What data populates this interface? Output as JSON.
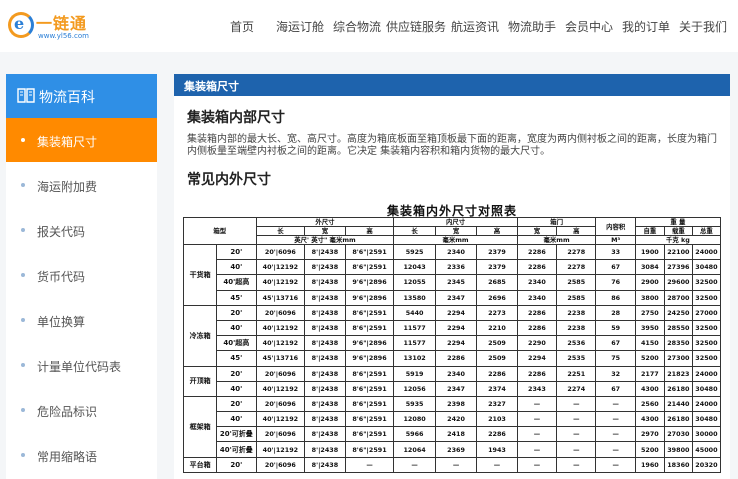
{
  "header": {
    "logo": {
      "name": "一链通",
      "url": "www.yl56.com",
      "mark": "e"
    },
    "nav": [
      "首页",
      "海运订舱",
      "综合物流",
      "供应链服务",
      "航运资讯",
      "物流助手",
      "会员中心",
      "我的订单",
      "关于我们"
    ]
  },
  "sidebar": {
    "title": "物流百科",
    "icon": "book-icon",
    "items": [
      "集装箱尺寸",
      "海运附加费",
      "报关代码",
      "货币代码",
      "单位换算",
      "计量单位代码表",
      "危险品标识",
      "常用缩略语"
    ],
    "active_index": 0
  },
  "content": {
    "bar_title": "集装箱尺寸",
    "heading1": "集装箱内部尺寸",
    "paragraph": "集装箱内部的最大长、宽、高尺寸。高度为箱底板面至箱顶板最下面的距离，宽度为两内侧衬板之间的距离，长度为箱门内侧板量至端壁内衬板之间的距离。它决定 集装箱内容积和箱内货物的最大尺寸。",
    "heading2": "常见内外尺寸",
    "table": {
      "title": "集装箱内外尺寸对照表",
      "header_row1": [
        "箱型",
        "外尺寸",
        "内尺寸",
        "箱门",
        "内容积",
        "重 量"
      ],
      "header_row2": [
        "长",
        "宽",
        "高",
        "长",
        "宽",
        "高",
        "宽",
        "高",
        "自重",
        "载重",
        "总重"
      ],
      "header_row3": [
        "英尺' 英寸\" 毫米mm",
        "毫米mm",
        "毫米mm",
        "M³",
        "千克 kg"
      ],
      "groups": [
        {
          "type": "干货箱",
          "rows": [
            [
              "20'",
              "20'|6096",
              "8'|2438",
              "8'6\"|2591",
              "5925",
              "2340",
              "2379",
              "2286",
              "2278",
              "33",
              "1900",
              "22100",
              "24000"
            ],
            [
              "40'",
              "40'|12192",
              "8'|2438",
              "8'6\"|2591",
              "12043",
              "2336",
              "2379",
              "2286",
              "2278",
              "67",
              "3084",
              "27396",
              "30480"
            ],
            [
              "40'超高",
              "40'|12192",
              "8'|2438",
              "9'6\"|2896",
              "12055",
              "2345",
              "2685",
              "2340",
              "2585",
              "76",
              "2900",
              "29600",
              "32500"
            ],
            [
              "45'",
              "45'|13716",
              "8'|2438",
              "9'6\"|2896",
              "13580",
              "2347",
              "2696",
              "2340",
              "2585",
              "86",
              "3800",
              "28700",
              "32500"
            ]
          ]
        },
        {
          "type": "冷冻箱",
          "rows": [
            [
              "20'",
              "20'|6096",
              "8'|2438",
              "8'6\"|2591",
              "5440",
              "2294",
              "2273",
              "2286",
              "2238",
              "28",
              "2750",
              "24250",
              "27000"
            ],
            [
              "40'",
              "40'|12192",
              "8'|2438",
              "8'6\"|2591",
              "11577",
              "2294",
              "2210",
              "2286",
              "2238",
              "59",
              "3950",
              "28550",
              "32500"
            ],
            [
              "40'超高",
              "40'|12192",
              "8'|2438",
              "9'6\"|2896",
              "11577",
              "2294",
              "2509",
              "2290",
              "2536",
              "67",
              "4150",
              "28350",
              "32500"
            ],
            [
              "45'",
              "45'|13716",
              "8'|2438",
              "9'6\"|2896",
              "13102",
              "2286",
              "2509",
              "2294",
              "2535",
              "75",
              "5200",
              "27300",
              "32500"
            ]
          ]
        },
        {
          "type": "开顶箱",
          "rows": [
            [
              "20'",
              "20'|6096",
              "8'|2438",
              "8'6\"|2591",
              "5919",
              "2340",
              "2286",
              "2286",
              "2251",
              "32",
              "2177",
              "21823",
              "24000"
            ],
            [
              "40'",
              "40'|12192",
              "8'|2438",
              "8'6\"|2591",
              "12056",
              "2347",
              "2374",
              "2343",
              "2274",
              "67",
              "4300",
              "26180",
              "30480"
            ]
          ]
        },
        {
          "type": "框架箱",
          "rows": [
            [
              "20'",
              "20'|6096",
              "8'|2438",
              "8'6\"|2591",
              "5935",
              "2398",
              "2327",
              "—",
              "—",
              "—",
              "2560",
              "21440",
              "24000"
            ],
            [
              "40'",
              "40'|12192",
              "8'|2438",
              "8'6\"|2591",
              "12080",
              "2420",
              "2103",
              "—",
              "—",
              "—",
              "4300",
              "26180",
              "30480"
            ],
            [
              "20'可折叠",
              "20'|6096",
              "8'|2438",
              "8'6\"|2591",
              "5966",
              "2418",
              "2286",
              "—",
              "—",
              "—",
              "2970",
              "27030",
              "30000"
            ],
            [
              "40'可折叠",
              "40'|12192",
              "8'|2438",
              "8'6\"|2591",
              "12064",
              "2369",
              "1943",
              "—",
              "—",
              "—",
              "5200",
              "39800",
              "45000"
            ]
          ]
        },
        {
          "type": "平台箱",
          "rows": [
            [
              "20'",
              "20'|6096",
              "8'|2438",
              "—",
              "—",
              "—",
              "—",
              "—",
              "—",
              "—",
              "1960",
              "18360",
              "20320"
            ]
          ]
        }
      ]
    }
  }
}
